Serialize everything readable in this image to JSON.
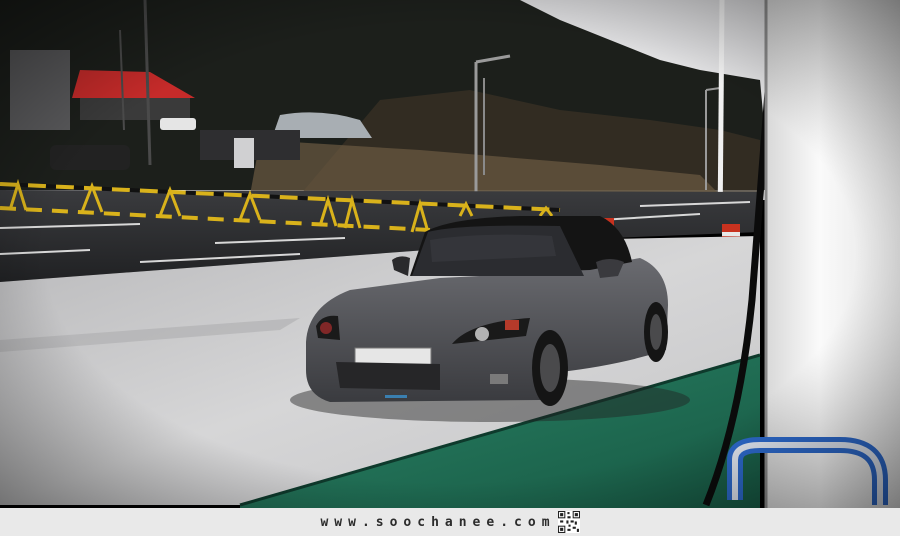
{
  "photo": {
    "description_colors": {
      "sky": "#e4e4e6",
      "hillside": "#1c1f1b",
      "road": "#2a2a2c",
      "forecourt": "#cfcfd0",
      "green_floor": "#1f6e55",
      "car_body": "#55565b",
      "car_top": "#141414",
      "pillar": "#f2f2f2",
      "barrier_yellow": "#d9b21b",
      "tent_red": "#c62b2a",
      "bollard_red": "#c8321f",
      "hose_blue": "#2c68c9"
    },
    "license_plate_text": ""
  },
  "caption": {
    "url": "www.soochanee.com",
    "qr_icon": "qr-code-icon"
  }
}
